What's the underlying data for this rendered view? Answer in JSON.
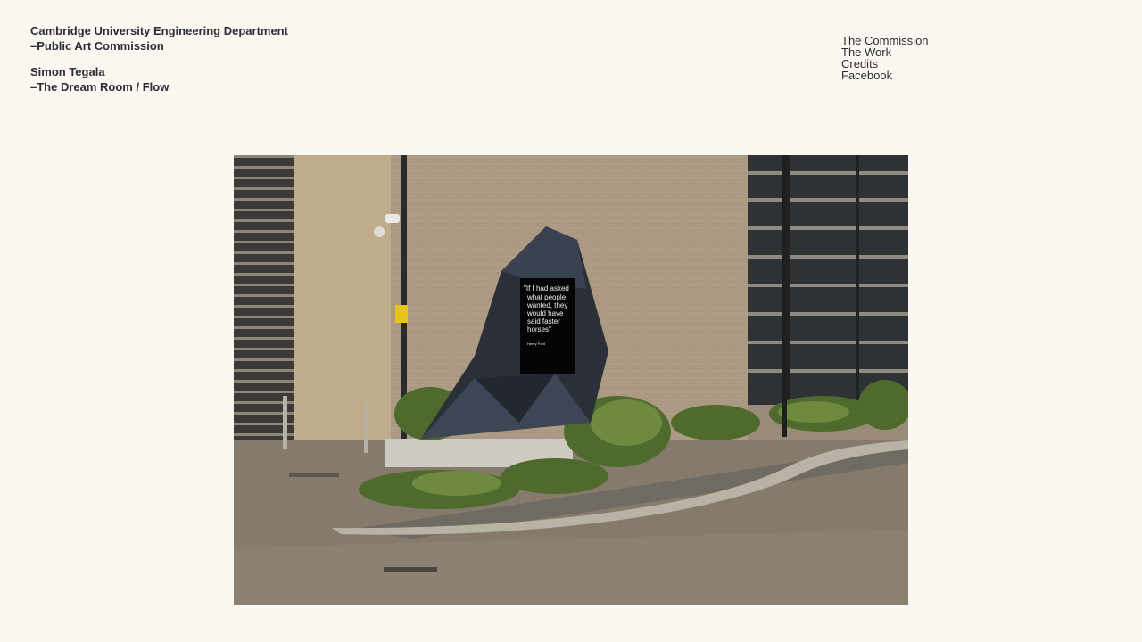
{
  "header": {
    "line1": "Cambridge University Engineering Department",
    "line2": "–Public Art Commission",
    "line3": "Simon Tegala",
    "line4": "–The Dream Room / Flow"
  },
  "nav": {
    "items": [
      "The Commission",
      "The Work",
      "Credits",
      "Facebook"
    ]
  },
  "photo": {
    "plaque_lines": [
      "\"If I had asked",
      "what people",
      "wanted, they",
      "would have",
      "said faster",
      "horses\""
    ],
    "plaque_attribution": "Henry Ford"
  }
}
